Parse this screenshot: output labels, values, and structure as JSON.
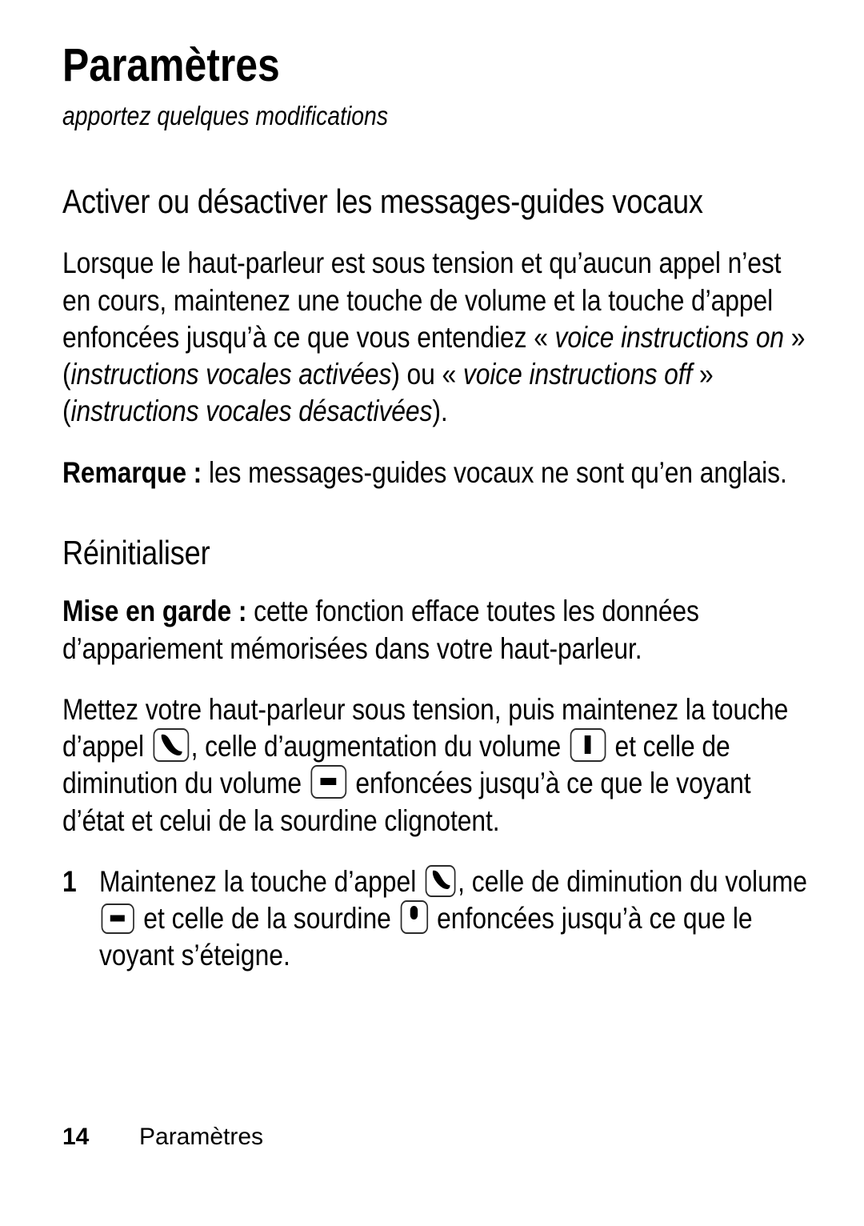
{
  "document": {
    "title": "Paramètres",
    "subtitle": "apportez quelques modifications"
  },
  "sections": [
    {
      "heading": "Activer ou désactiver les messages-guides vocaux",
      "paragraph1": {
        "part1": "Lorsque le haut-parleur est sous tension et qu’aucun appel n’est en cours, maintenez une touche de volume et la touche d’appel enfoncées jusqu’à ce que vous entendiez « ",
        "italic1": "voice instructions on",
        "part2": " » (",
        "italic2": "instructions vocales activées",
        "part3": ") ou « ",
        "italic3": "voice instructions off",
        "part4": " » (",
        "italic4": "instructions vocales désactivées",
        "part5": ")."
      },
      "note": {
        "label": "Remarque :",
        "text": " les messages-guides vocaux ne sont qu’en anglais."
      }
    },
    {
      "heading": "Réinitialiser",
      "caution": {
        "label": "Mise en garde :",
        "text": " cette fonction efface toutes les données d’appariement mémorisées dans votre haut-parleur."
      },
      "paragraph2": {
        "part1": "Mettez votre haut-parleur sous tension, puis maintenez la touche d’appel ",
        "part2": ", celle d’augmentation du volume ",
        "part3": " et celle de diminution du volume ",
        "part4": " enfoncées jusqu’à ce que le voyant d’état et celui de la sourdine clignotent."
      },
      "steps": [
        {
          "number": "1",
          "part1": "Maintenez la touche d’appel ",
          "part2": ", celle de diminution du volume ",
          "part3": " et celle de la sourdine ",
          "part4": " enfoncées jusqu’à ce que le voyant s’éteigne."
        }
      ]
    }
  ],
  "icons": {
    "call": "phone-handset-icon",
    "volume_up": "plus-icon",
    "volume_down": "minus-icon",
    "mute": "microphone-icon"
  },
  "footer": {
    "page_number": "14",
    "section_name": "Paramètres"
  },
  "colors": {
    "text": "#000000",
    "background": "#ffffff",
    "icon_border": "#2b2b2b"
  }
}
